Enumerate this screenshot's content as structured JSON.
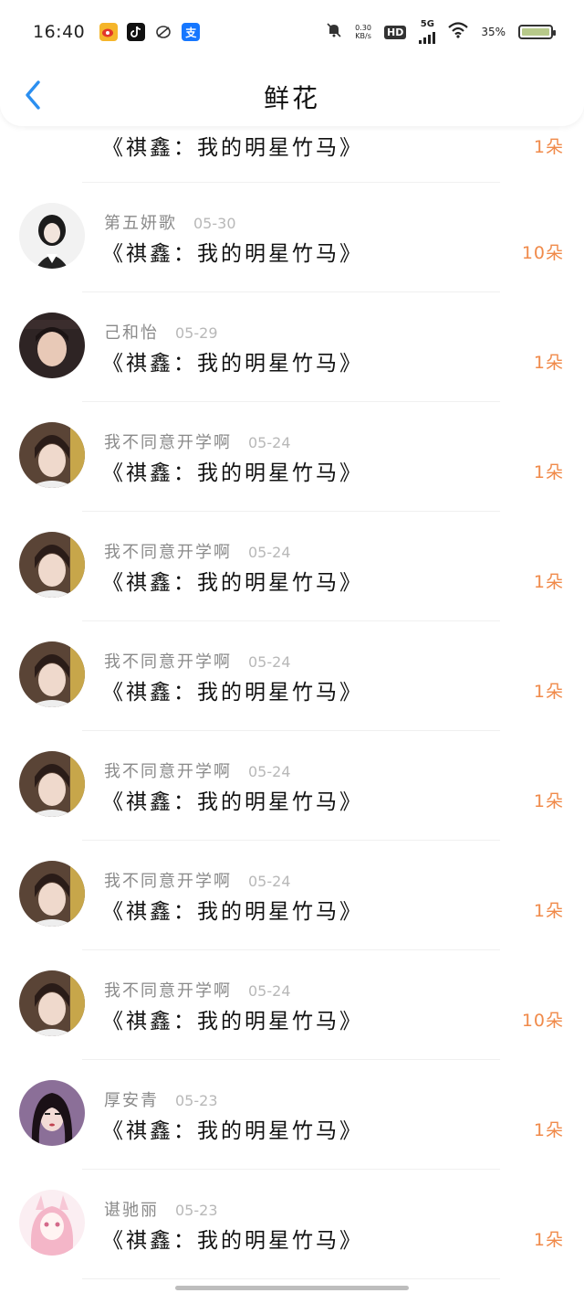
{
  "status": {
    "time": "16:40",
    "netspeed_value": "0.30",
    "netspeed_unit": "KB/s",
    "hd": "HD",
    "network": "5G",
    "battery_pct": "35%"
  },
  "header": {
    "title": "鲜花"
  },
  "rows": [
    {
      "name": "",
      "date": "",
      "title": "《祺鑫：我的明星竹马》",
      "count": "1朵",
      "avatar_color": "#3a2a44"
    },
    {
      "name": "第五妍歌",
      "date": "05-30",
      "title": "《祺鑫：我的明星竹马》",
      "count": "10朵",
      "avatar_color": "#2b2b2b"
    },
    {
      "name": "己和怡",
      "date": "05-29",
      "title": "《祺鑫：我的明星竹马》",
      "count": "1朵",
      "avatar_color": "#4b3b3b"
    },
    {
      "name": "我不同意开学啊",
      "date": "05-24",
      "title": "《祺鑫：我的明星竹马》",
      "count": "1朵",
      "avatar_color": "#3a2e2a"
    },
    {
      "name": "我不同意开学啊",
      "date": "05-24",
      "title": "《祺鑫：我的明星竹马》",
      "count": "1朵",
      "avatar_color": "#3a2e2a"
    },
    {
      "name": "我不同意开学啊",
      "date": "05-24",
      "title": "《祺鑫：我的明星竹马》",
      "count": "1朵",
      "avatar_color": "#3a2e2a"
    },
    {
      "name": "我不同意开学啊",
      "date": "05-24",
      "title": "《祺鑫：我的明星竹马》",
      "count": "1朵",
      "avatar_color": "#3a2e2a"
    },
    {
      "name": "我不同意开学啊",
      "date": "05-24",
      "title": "《祺鑫：我的明星竹马》",
      "count": "1朵",
      "avatar_color": "#3a2e2a"
    },
    {
      "name": "我不同意开学啊",
      "date": "05-24",
      "title": "《祺鑫：我的明星竹马》",
      "count": "10朵",
      "avatar_color": "#3a2e2a"
    },
    {
      "name": "厚安青",
      "date": "05-23",
      "title": "《祺鑫：我的明星竹马》",
      "count": "1朵",
      "avatar_color": "#6b3a5a"
    },
    {
      "name": "谌驰丽",
      "date": "05-23",
      "title": "《祺鑫：我的明星竹马》",
      "count": "1朵",
      "avatar_color": "#f3c9d4"
    }
  ],
  "colors": {
    "accent_blue": "#2b8ff0",
    "count_orange": "#f08a4a"
  }
}
